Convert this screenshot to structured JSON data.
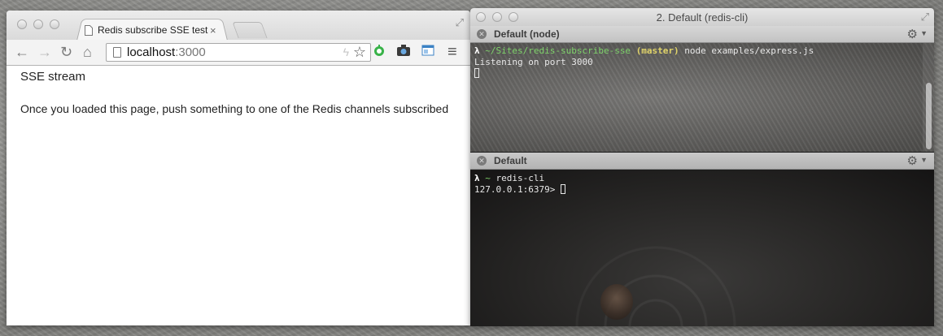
{
  "browser": {
    "tab_title": "Redis subscribe SSE test",
    "tab_close": "×",
    "url_host": "localhost",
    "url_port": ":3000",
    "page_heading": "SSE stream",
    "page_text": "Once you loaded this page, push something to one of the Redis channels subscribed",
    "icons": {
      "back": "←",
      "forward": "→",
      "reload": "↻",
      "home": "⌂",
      "bolt": "ϟ",
      "star": "☆",
      "menu": "≡",
      "expand": "⤢"
    }
  },
  "terminal": {
    "window_title": "2. Default (redis-cli)",
    "pane1": {
      "title": "Default (node)",
      "prompt_symbol": "λ",
      "cwd": "~/Sites/redis-subscribe-sse",
      "branch": "(master)",
      "command": "node examples/express.js",
      "output": "Listening on port 3000"
    },
    "pane2": {
      "title": "Default",
      "prompt_symbol": "λ",
      "cwd": "~",
      "command": "redis-cli",
      "redis_prompt": "127.0.0.1:6379>"
    },
    "icons": {
      "close": "✕",
      "gear": "⚙",
      "caret": "▼",
      "expand": "⤢"
    }
  },
  "colors": {
    "path_green": "#7fd36b",
    "branch_yellow": "#e2d56a"
  }
}
